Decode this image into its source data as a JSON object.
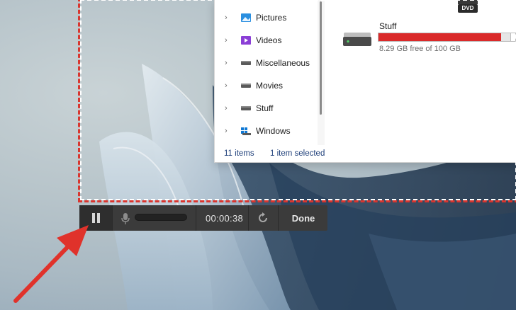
{
  "explorer": {
    "nav_items": [
      {
        "label": "Pictures",
        "icon": "pictures-icon"
      },
      {
        "label": "Videos",
        "icon": "videos-icon"
      },
      {
        "label": "Miscellaneous",
        "icon": "drive-icon"
      },
      {
        "label": "Movies",
        "icon": "drive-icon"
      },
      {
        "label": "Stuff",
        "icon": "drive-icon"
      },
      {
        "label": "Windows",
        "icon": "windows-drive-icon"
      }
    ],
    "dvd_label": "DVD",
    "drive": {
      "name": "Stuff",
      "free_text": "8.29 GB free of 100 GB",
      "used_fraction": 0.917
    },
    "status": {
      "item_count": "11 items",
      "selected": "1 item selected"
    }
  },
  "recorder": {
    "timer": "00:00:38",
    "done_label": "Done"
  },
  "colors": {
    "frame_red": "#d9362f",
    "drive_bar_red": "#da2a2a",
    "toolbar_bg": "#3b3b3b",
    "arrow_red": "#e0322b"
  }
}
